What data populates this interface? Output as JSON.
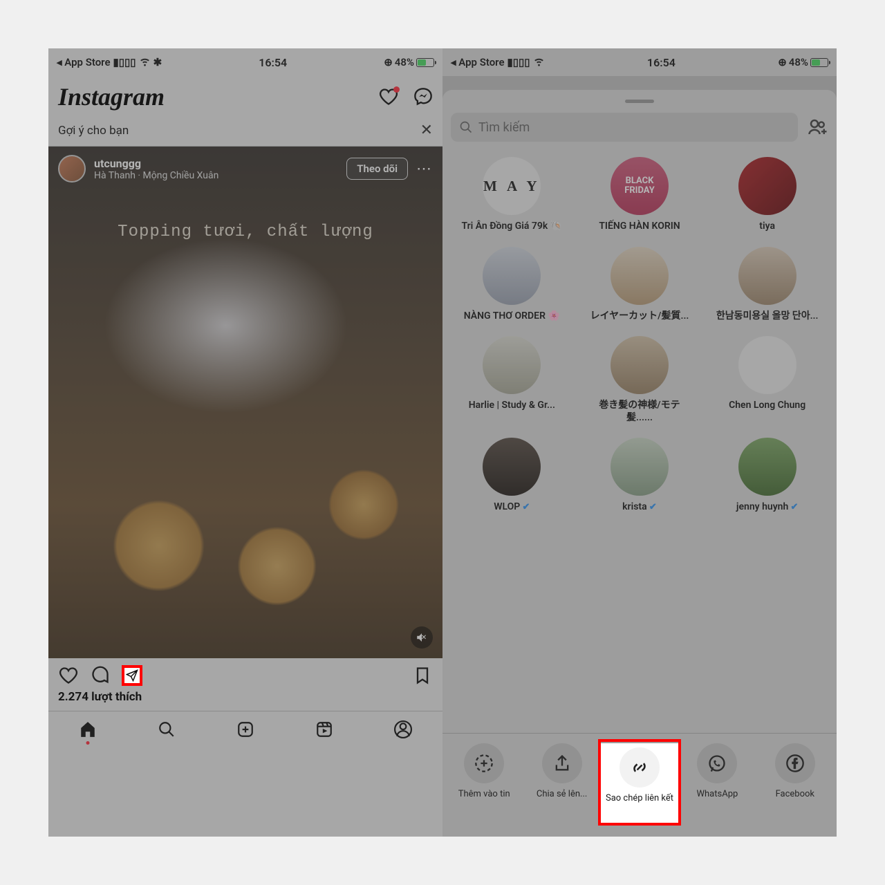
{
  "status": {
    "back_label": "◂ App Store",
    "signal": "▮▮▮▮",
    "wifi": "✓",
    "time": "16:54",
    "battery_text": "48%",
    "location_icon": "⊙"
  },
  "left": {
    "app_name": "Instagram",
    "suggestion_label": "Gợi ý cho bạn",
    "post": {
      "username": "utcunggg",
      "subtitle": "Hà Thanh · Mộng Chiều Xuân",
      "follow_label": "Theo dõi",
      "caption_overlay": "Topping tươi, chất lượng"
    },
    "likes_text": "2.274 lượt thích"
  },
  "right": {
    "search_placeholder": "Tìm kiếm",
    "contacts": [
      {
        "name": "Tri Ân Đồng Giá 79k 🐚",
        "avatar_label": "M A Y"
      },
      {
        "name": "TIẾNG HÀN KORIN",
        "avatar_label": "BLACK FRIDAY"
      },
      {
        "name": "tiya",
        "avatar_label": ""
      },
      {
        "name": "NÀNG THƠ ORDER 🌸",
        "avatar_label": ""
      },
      {
        "name": "レイヤーカット/髪質...",
        "avatar_label": ""
      },
      {
        "name": "한남동미용실 올망 단아...",
        "avatar_label": ""
      },
      {
        "name": "Harlie | Study & Gr...",
        "avatar_label": ""
      },
      {
        "name": "巻き髪の神様/モテ髪......",
        "avatar_label": ""
      },
      {
        "name": "Chen Long Chung",
        "avatar_label": ""
      },
      {
        "name": "WLOP",
        "avatar_label": "",
        "verified": true
      },
      {
        "name": "krista",
        "avatar_label": "",
        "verified": true
      },
      {
        "name": "jenny huynh",
        "avatar_label": "",
        "verified": true
      }
    ],
    "share_options": [
      {
        "label": "Thêm vào tin",
        "icon": "add-story"
      },
      {
        "label": "Chia sẻ lên...",
        "icon": "share-up"
      },
      {
        "label": "Sao chép liên kết",
        "icon": "link"
      },
      {
        "label": "WhatsApp",
        "icon": "whatsapp"
      },
      {
        "label": "Facebook",
        "icon": "facebook"
      }
    ]
  }
}
